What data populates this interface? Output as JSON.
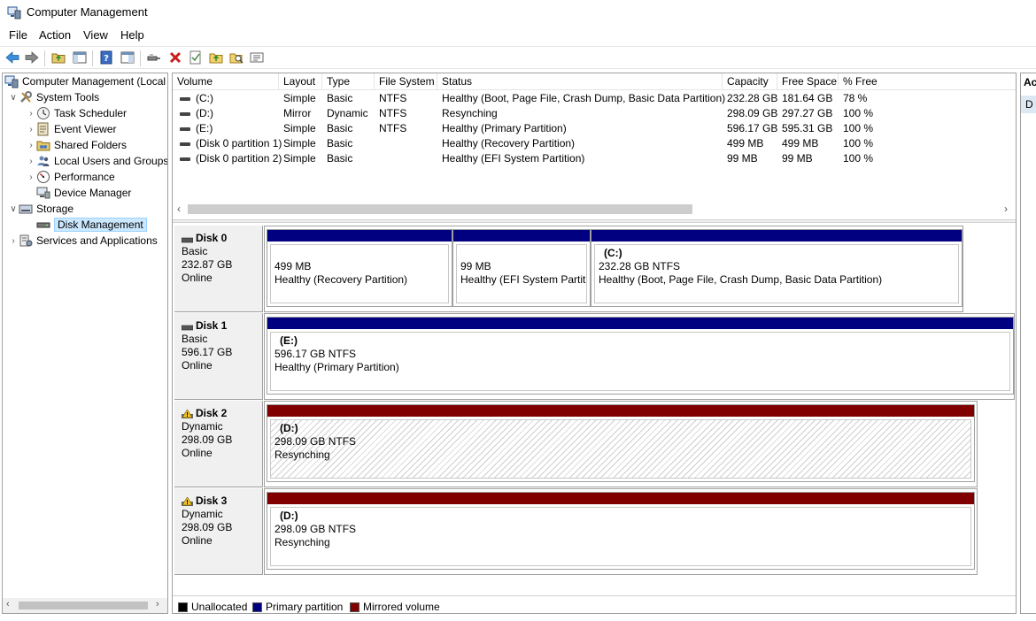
{
  "window": {
    "title": "Computer Management"
  },
  "menu": [
    "File",
    "Action",
    "View",
    "Help"
  ],
  "toolbar": [
    "back-icon",
    "forward-icon",
    "up-folder-icon",
    "show-hide-tree-icon",
    "help-icon",
    "properties-icon",
    "connect-icon",
    "delete-icon",
    "check-icon",
    "folder-up-icon",
    "search-folder-icon",
    "export-list-icon"
  ],
  "tree": [
    {
      "label": "Computer Management (Local",
      "icon": "computer-management-icon",
      "indent": 0,
      "chevron": ""
    },
    {
      "label": "System Tools",
      "icon": "tools-icon",
      "indent": 1,
      "chevron": "∨"
    },
    {
      "label": "Task Scheduler",
      "icon": "clock-icon",
      "indent": 2,
      "chevron": "›"
    },
    {
      "label": "Event Viewer",
      "icon": "event-viewer-icon",
      "indent": 2,
      "chevron": "›"
    },
    {
      "label": "Shared Folders",
      "icon": "shared-folder-icon",
      "indent": 2,
      "chevron": "›"
    },
    {
      "label": "Local Users and Groups",
      "icon": "users-icon",
      "indent": 2,
      "chevron": "›"
    },
    {
      "label": "Performance",
      "icon": "performance-icon",
      "indent": 2,
      "chevron": "›"
    },
    {
      "label": "Device Manager",
      "icon": "device-manager-icon",
      "indent": 2,
      "chevron": ""
    },
    {
      "label": "Storage",
      "icon": "storage-icon",
      "indent": 1,
      "chevron": "∨"
    },
    {
      "label": "Disk Management",
      "icon": "disk-management-icon",
      "indent": 2,
      "chevron": "",
      "selected": true
    },
    {
      "label": "Services and Applications",
      "icon": "services-icon",
      "indent": 1,
      "chevron": "›"
    }
  ],
  "columns": [
    "Volume",
    "Layout",
    "Type",
    "File System",
    "Status",
    "Capacity",
    "Free Space",
    "% Free"
  ],
  "volumes": [
    [
      "(C:)",
      "Simple",
      "Basic",
      "NTFS",
      "Healthy (Boot, Page File, Crash Dump, Basic Data Partition)",
      "232.28 GB",
      "181.64 GB",
      "78 %"
    ],
    [
      "(D:)",
      "Mirror",
      "Dynamic",
      "NTFS",
      "Resynching",
      "298.09 GB",
      "297.27 GB",
      "100 %"
    ],
    [
      "(E:)",
      "Simple",
      "Basic",
      "NTFS",
      "Healthy (Primary Partition)",
      "596.17 GB",
      "595.31 GB",
      "100 %"
    ],
    [
      "(Disk 0 partition 1)",
      "Simple",
      "Basic",
      "",
      "Healthy (Recovery Partition)",
      "499 MB",
      "499 MB",
      "100 %"
    ],
    [
      "(Disk 0 partition 2)",
      "Simple",
      "Basic",
      "",
      "Healthy (EFI System Partition)",
      "99 MB",
      "99 MB",
      "100 %"
    ]
  ],
  "disks": [
    {
      "name": "Disk 0",
      "type": "Basic",
      "size": "232.87 GB",
      "status": "Online",
      "warning": false,
      "partitions": [
        {
          "name": "",
          "line1": "499 MB",
          "line2": "Healthy (Recovery Partition)",
          "kind": "primary",
          "hatched": false
        },
        {
          "name": "",
          "line1": "99 MB",
          "line2": "Healthy (EFI System Partiti",
          "kind": "primary",
          "hatched": false
        },
        {
          "name": "(C:)",
          "line1": "232.28 GB NTFS",
          "line2": "Healthy (Boot, Page File, Crash Dump, Basic Data Partition)",
          "kind": "primary",
          "hatched": false
        }
      ]
    },
    {
      "name": "Disk 1",
      "type": "Basic",
      "size": "596.17 GB",
      "status": "Online",
      "warning": false,
      "partitions": [
        {
          "name": "(E:)",
          "line1": "596.17 GB NTFS",
          "line2": "Healthy (Primary Partition)",
          "kind": "primary",
          "hatched": false
        }
      ]
    },
    {
      "name": "Disk 2",
      "type": "Dynamic",
      "size": "298.09 GB",
      "status": "Online",
      "warning": true,
      "partitions": [
        {
          "name": "(D:)",
          "line1": "298.09 GB NTFS",
          "line2": "Resynching",
          "kind": "mirrored",
          "hatched": true
        }
      ]
    },
    {
      "name": "Disk 3",
      "type": "Dynamic",
      "size": "298.09 GB",
      "status": "Online",
      "warning": true,
      "partitions": [
        {
          "name": "(D:)",
          "line1": "298.09 GB NTFS",
          "line2": "Resynching",
          "kind": "mirrored",
          "hatched": false
        }
      ]
    }
  ],
  "legend": [
    {
      "label": "Unallocated",
      "color": "#000000"
    },
    {
      "label": "Primary partition",
      "color": "#000080"
    },
    {
      "label": "Mirrored volume",
      "color": "#800000"
    }
  ],
  "colors": {
    "primary": "#000080",
    "mirrored": "#800000",
    "selection": "#cce8ff"
  },
  "actions": {
    "header": "Ac",
    "item": "D"
  }
}
